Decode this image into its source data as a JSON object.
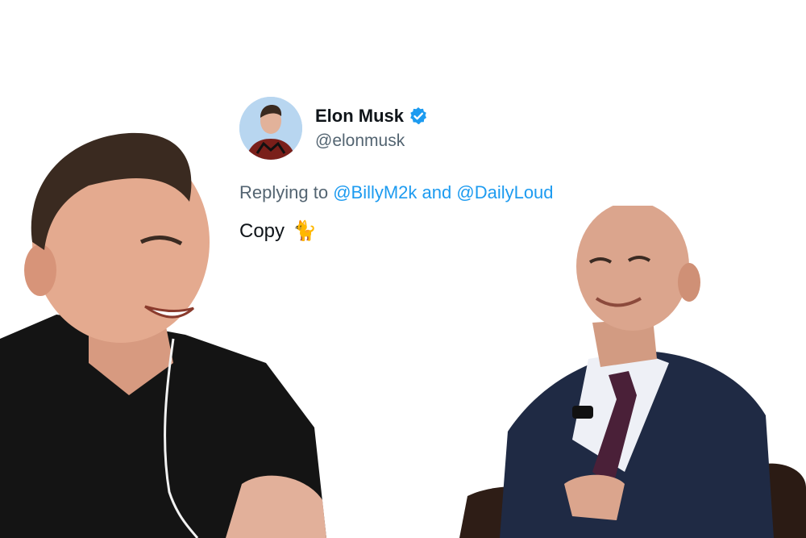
{
  "tweet": {
    "display_name": "Elon Musk",
    "handle": "@elonmusk",
    "verified": true,
    "reply_prefix": "Replying to ",
    "mention_1": "@BillyM2k",
    "reply_and": " and ",
    "mention_2": "@DailyLoud",
    "text": "Copy",
    "emoji_icon": "cat-icon",
    "emoji": "🐈"
  },
  "colors": {
    "accent": "#1d9bf0",
    "secondary_text": "#536471",
    "primary_text": "#0f1419",
    "background": "#ffffff"
  }
}
